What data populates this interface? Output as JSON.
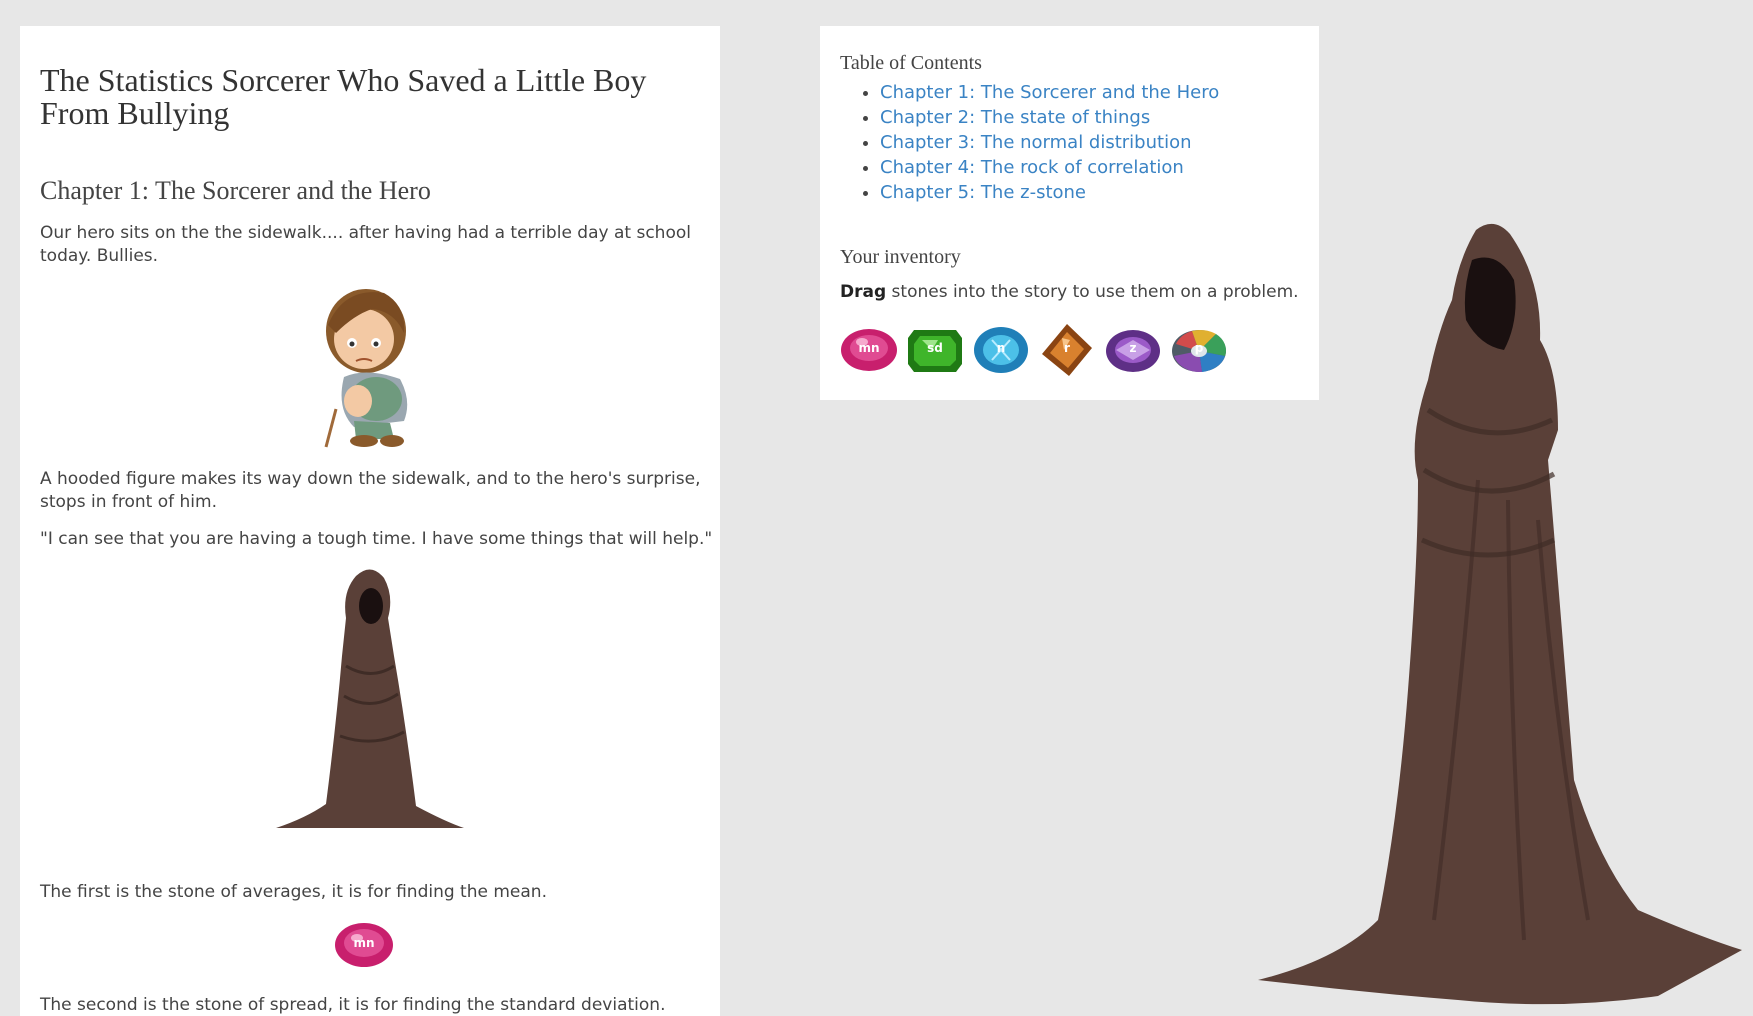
{
  "story": {
    "title": "The Statistics Sorcerer Who Saved a Little Boy From Bullying",
    "chapter_heading": "Chapter 1: The Sorcerer and the Hero",
    "paragraphs": [
      "Our hero sits on the the sidewalk.... after having had a terrible day at school today. Bullies.",
      "A hooded figure makes its way down the sidewalk, and to the hero's surprise, stops in front of him.",
      "\"I can see that you are having a tough time. I have some things that will help.\"",
      "The first is the stone of averages, it is for finding the mean.",
      "The second is the stone of spread, it is for finding the standard deviation."
    ],
    "inline_stone_label": "mn"
  },
  "sidebar": {
    "toc_title": "Table of Contents",
    "toc": [
      "Chapter 1: The Sorcerer and the Hero",
      "Chapter 2: The state of things",
      "Chapter 3: The normal distribution",
      "Chapter 4: The rock of correlation",
      "Chapter 5: The z-stone"
    ],
    "inventory_title": "Your inventory",
    "inventory_hint_bold": "Drag",
    "inventory_hint_rest": " stones into the story to use them on a problem.",
    "stones": [
      {
        "label": "mn",
        "color": "#d4257a",
        "icon": "pink-gem-icon"
      },
      {
        "label": "sd",
        "color": "#2f9a1e",
        "icon": "green-gem-icon"
      },
      {
        "label": "n",
        "color": "#2b9bd1",
        "icon": "blue-gem-icon"
      },
      {
        "label": "r",
        "color": "#c26a1c",
        "icon": "amber-gem-icon"
      },
      {
        "label": "z",
        "color": "#8a4cb0",
        "icon": "purple-gem-icon"
      },
      {
        "label": "p",
        "color": "#6d7a8a",
        "icon": "rainbow-gem-icon"
      }
    ]
  }
}
